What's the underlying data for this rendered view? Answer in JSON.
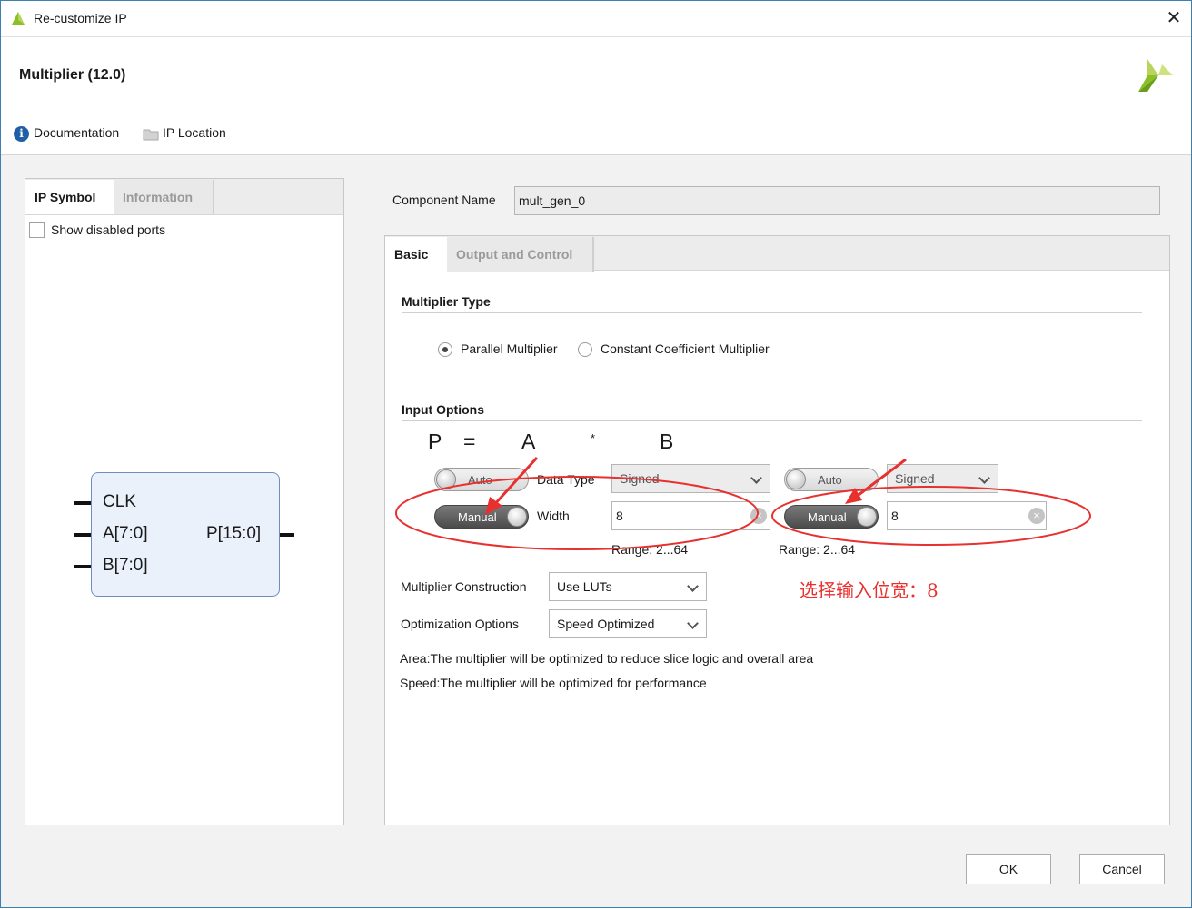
{
  "window": {
    "title": "Re-customize IP"
  },
  "header": {
    "ip_title": "Multiplier (12.0)",
    "documentation_label": "Documentation",
    "ip_location_label": "IP Location"
  },
  "left_panel": {
    "tabs": [
      {
        "label": "IP Symbol"
      },
      {
        "label": "Information"
      }
    ],
    "show_disabled_ports_label": "Show disabled ports",
    "symbol": {
      "ports_in": [
        "CLK",
        "A[7:0]",
        "B[7:0]"
      ],
      "port_out": "P[15:0]"
    }
  },
  "right_panel": {
    "component_name_label": "Component Name",
    "component_name_value": "mult_gen_0",
    "tabs": [
      {
        "label": "Basic"
      },
      {
        "label": "Output and Control"
      }
    ],
    "multiplier_type": {
      "section_title": "Multiplier Type",
      "options": [
        {
          "label": "Parallel Multiplier",
          "selected": true
        },
        {
          "label": "Constant Coefficient Multiplier",
          "selected": false
        }
      ]
    },
    "input_options": {
      "section_title": "Input Options",
      "equation": {
        "p": "P",
        "eq": "=",
        "a": "A",
        "times": "*",
        "b": "B"
      },
      "data_type_label": "Data Type",
      "width_label": "Width",
      "a": {
        "auto_toggle": "Auto",
        "data_type": "Signed",
        "width_toggle": "Manual",
        "width_value": "8",
        "range": "Range: 2...64"
      },
      "b": {
        "auto_toggle": "Auto",
        "data_type": "Signed",
        "width_toggle": "Manual",
        "width_value": "8",
        "range": "Range: 2...64"
      }
    },
    "multiplier_construction": {
      "label": "Multiplier Construction",
      "value": "Use LUTs"
    },
    "optimization_options": {
      "label": "Optimization Options",
      "value": "Speed Optimized"
    },
    "notes": [
      "Area:The multiplier will be optimized to reduce slice logic and overall area",
      "Speed:The multiplier will be optimized for performance"
    ]
  },
  "annotation": {
    "text": "选择输入位宽：8",
    "color": "#e8312f"
  },
  "footer": {
    "ok_label": "OK",
    "cancel_label": "Cancel"
  },
  "colors": {
    "accent_blue": "#1f5fa8",
    "xilinx_green": "#8cbf26",
    "annotation_red": "#e8312f"
  }
}
